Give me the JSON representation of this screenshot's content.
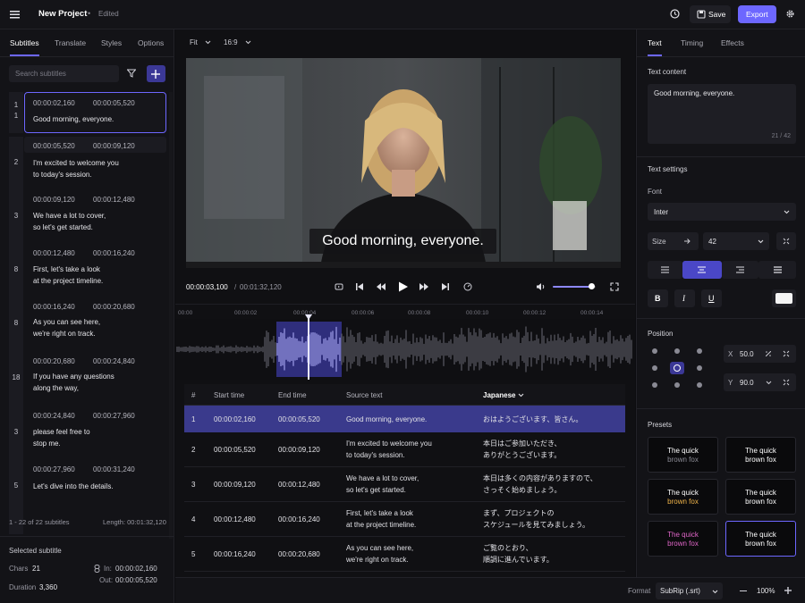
{
  "app": {
    "title": "New Project",
    "separator": "•",
    "status": "Edited",
    "save_label": "Save",
    "export_label": "Export",
    "accent": "#6d67ff"
  },
  "left": {
    "tabs": [
      "Subtitles",
      "Translate",
      "Styles",
      "Options"
    ],
    "search_placeholder": "Search subtitles",
    "cues": [
      {
        "num": "1",
        "start": "00:00:02,160",
        "end": "00:00:05,520",
        "text": "Good morning, everyone."
      },
      {
        "num": "2",
        "start": "00:00:05,520",
        "end": "00:00:09,120",
        "text": "I'm excited to welcome you\nto today's session."
      },
      {
        "num": "3",
        "start": "00:00:09,120",
        "end": "00:00:12,480",
        "text": "We have a lot to cover,\nso let's get started."
      },
      {
        "num": "8",
        "start": "00:00:12,480",
        "end": "00:00:16,240",
        "text": "First, let's take a look\nat the project timeline."
      },
      {
        "num": "8",
        "start": "00:00:16,240",
        "end": "00:00:20,680",
        "text": "As you can see here,\nwe're right on track."
      },
      {
        "num": "18",
        "start": "00:00:20,680",
        "end": "00:00:24,840",
        "text": "If you have any questions\nalong the way,"
      },
      {
        "num": "3",
        "start": "00:00:24,840",
        "end": "00:00:27,960",
        "text": "please feel free to\nstop me."
      },
      {
        "num": "5",
        "start": "00:00:27,960",
        "end": "00:00:31,240",
        "text": "Let's dive into the details."
      }
    ],
    "footer_count": "1 - 22 of 22 subtitles",
    "footer_length": "Length: 00:01:32,120",
    "selected": {
      "heading": "Selected subtitle",
      "chars_label": "Chars",
      "chars": "21",
      "duration_label": "Duration",
      "duration": "3,360",
      "in_label": "In:",
      "in": "00:00:02,160",
      "out_label": "Out:",
      "out": "00:00:05,520"
    }
  },
  "player": {
    "fit": "Fit",
    "aspect": "16:9",
    "caption": "Good morning, everyone.",
    "current_time": "00:00:03,100",
    "time_sep": "/",
    "total_time": "00:01:32,120",
    "volume": 0.9,
    "ruler": [
      "00:00",
      "00:00:02",
      "00:00:04",
      "00:00:06",
      "00:00:08",
      "00:00:10",
      "00:00:12",
      "00:00:14"
    ]
  },
  "table": {
    "headers": [
      "#",
      "Start time",
      "End time",
      "Source text",
      "Japanese"
    ],
    "rows": [
      {
        "n": "1",
        "start": "00:00:02,160",
        "end": "00:00:05,520",
        "src": "Good morning, everyone.",
        "ja": "おはようございます、皆さん。"
      },
      {
        "n": "2",
        "start": "00:00:05,520",
        "end": "00:00:09,120",
        "src": "I'm excited to welcome you\nto today's session.",
        "ja": "本日はご参加いただき、\nありがとうございます。"
      },
      {
        "n": "3",
        "start": "00:00:09,120",
        "end": "00:00:12,480",
        "src": "We have a lot to cover,\nso let's get started.",
        "ja": "本日は多くの内容がありますので、\nさっそく始めましょう。"
      },
      {
        "n": "4",
        "start": "00:00:12,480",
        "end": "00:00:16,240",
        "src": "First, let's take a look\nat the project timeline.",
        "ja": "まず、プロジェクトの\nスケジュールを見てみましょう。"
      },
      {
        "n": "5",
        "start": "00:00:16,240",
        "end": "00:00:20,680",
        "src": "As you can see here,\nwe're right on track.",
        "ja": "ご覧のとおり、\n順調に進んでいます。"
      }
    ]
  },
  "right": {
    "tabs": [
      "Text",
      "Timing",
      "Effects"
    ],
    "content_label": "Text content",
    "content": "Good morning, everyone.",
    "counter": "21 / 42",
    "settings_label": "Text settings",
    "font_label": "Font",
    "font_value": "Inter",
    "size_label": "Size",
    "size_value": "42",
    "color_swatch": "#f4f4f4",
    "position_label": "Position",
    "x_label": "X",
    "x_value": "50.0",
    "y_label": "Y",
    "y_value": "90.0",
    "presets_label": "Presets",
    "presets": [
      {
        "l1": "The quick",
        "l2": "brown fox",
        "c1": "#ffffff",
        "c2": "#8c8c96"
      },
      {
        "l1": "The quick",
        "l2": "brown fox",
        "c1": "#ffffff",
        "c2": "#ffffff"
      },
      {
        "l1": "The quick",
        "l2": "brown fox",
        "c1": "#ffffff",
        "c2": "#f0b44a"
      },
      {
        "l1": "The quick",
        "l2": "brown fox",
        "c1": "#ffffff",
        "c2": "#ffffff"
      },
      {
        "l1": "The quick",
        "l2": "brown fox",
        "c1": "#e066c8",
        "c2": "#e066c8"
      },
      {
        "l1": "The quick",
        "l2": "brown fox",
        "c1": "#ffffff",
        "c2": "#ffffff"
      }
    ]
  },
  "bottom": {
    "format_label": "Format",
    "format_value": "SubRip (.srt)",
    "zoom": "100%"
  }
}
